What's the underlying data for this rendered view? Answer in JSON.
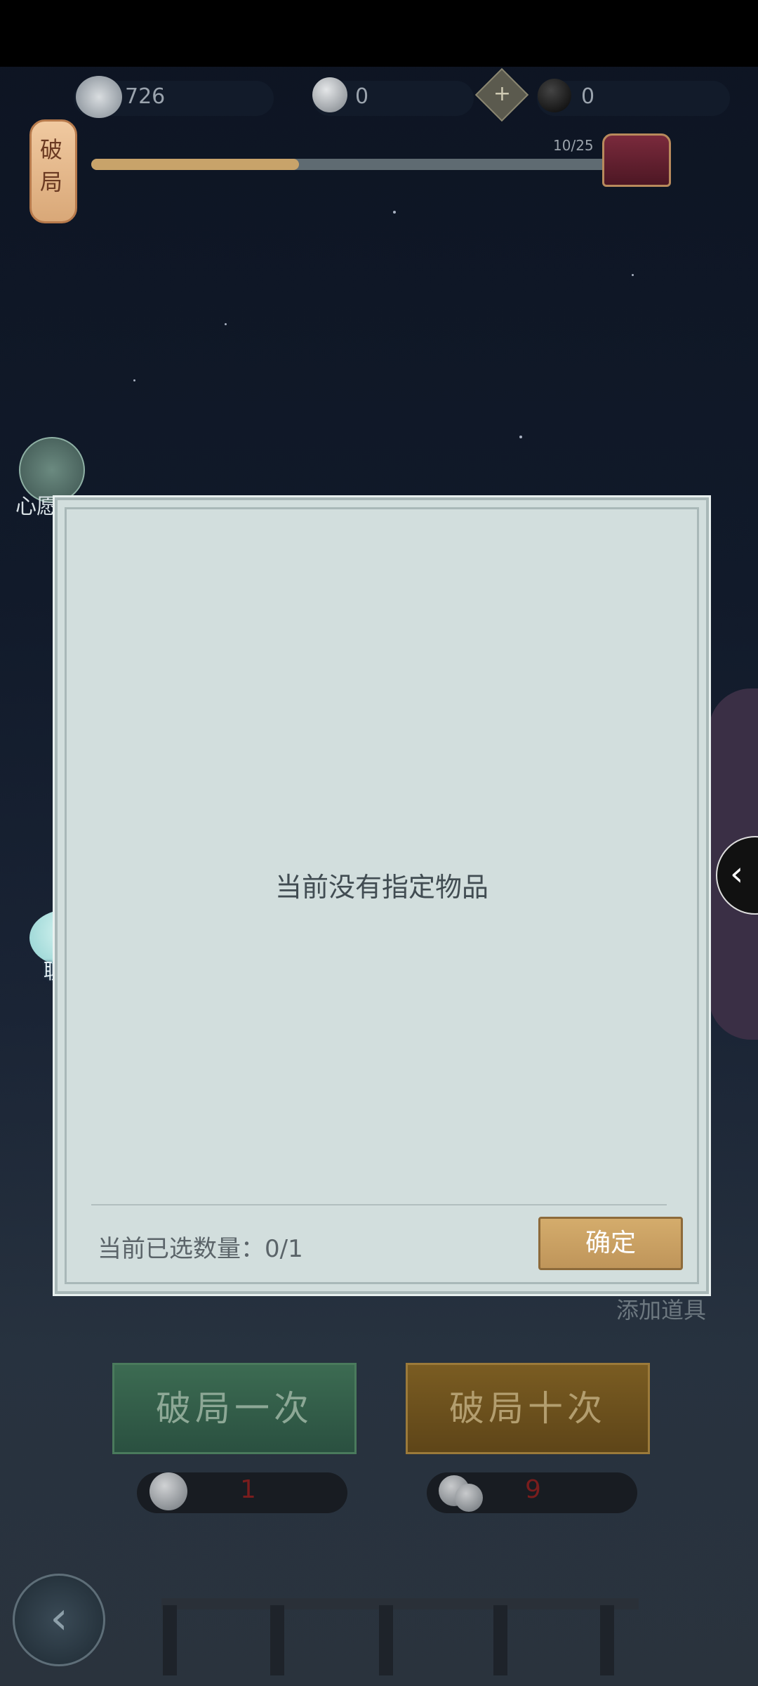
{
  "currency": {
    "silver": "726",
    "stone_white": "0",
    "stone_black": "0"
  },
  "lantern": {
    "text": "破局"
  },
  "progress": {
    "label": "10/25",
    "current": 10,
    "total": 25
  },
  "side_icons": {
    "wish_label": "心愿单",
    "chat_label": "聊天"
  },
  "modal": {
    "empty_text": "当前没有指定物品",
    "selected_count": "当前已选数量：0/1",
    "confirm_label": "确定"
  },
  "add_item_label": "添加道具",
  "actions": {
    "draw_once": "破局一次",
    "draw_ten": "破局十次",
    "cost_once": "1",
    "cost_ten": "9"
  }
}
